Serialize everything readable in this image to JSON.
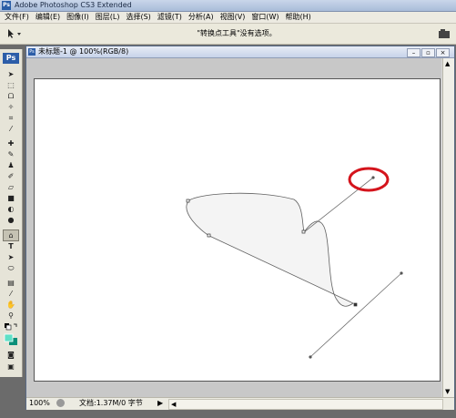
{
  "app": {
    "title": "Adobe Photoshop CS3 Extended",
    "logo": "Ps"
  },
  "menu": [
    "文件(F)",
    "编辑(E)",
    "图像(I)",
    "图层(L)",
    "选择(S)",
    "滤镜(T)",
    "分析(A)",
    "视图(V)",
    "窗口(W)",
    "帮助(H)"
  ],
  "options": {
    "hint": "\"转换点工具\"没有选项。"
  },
  "toolbox": {
    "badge": "Ps",
    "tools": [
      "move-icon",
      "marquee-icon",
      "lasso-icon",
      "magic-wand-icon",
      "crop-icon",
      "slice-icon",
      "healing-icon",
      "brush-icon",
      "stamp-icon",
      "history-brush-icon",
      "eraser-icon",
      "gradient-icon",
      "blur-icon",
      "dodge-icon",
      "pen-icon",
      "type-icon",
      "path-select-icon",
      "shape-icon",
      "notes-icon",
      "eyedropper-icon",
      "hand-icon",
      "zoom-icon"
    ]
  },
  "document": {
    "title": "未标题-1 @ 100%(RGB/8)",
    "zoom": "100%",
    "info": "文档:1.37M/0 字节"
  },
  "colors": {
    "highlight": "#d4141c",
    "path": "#555555",
    "shape_fill": "#f4f4f4"
  }
}
